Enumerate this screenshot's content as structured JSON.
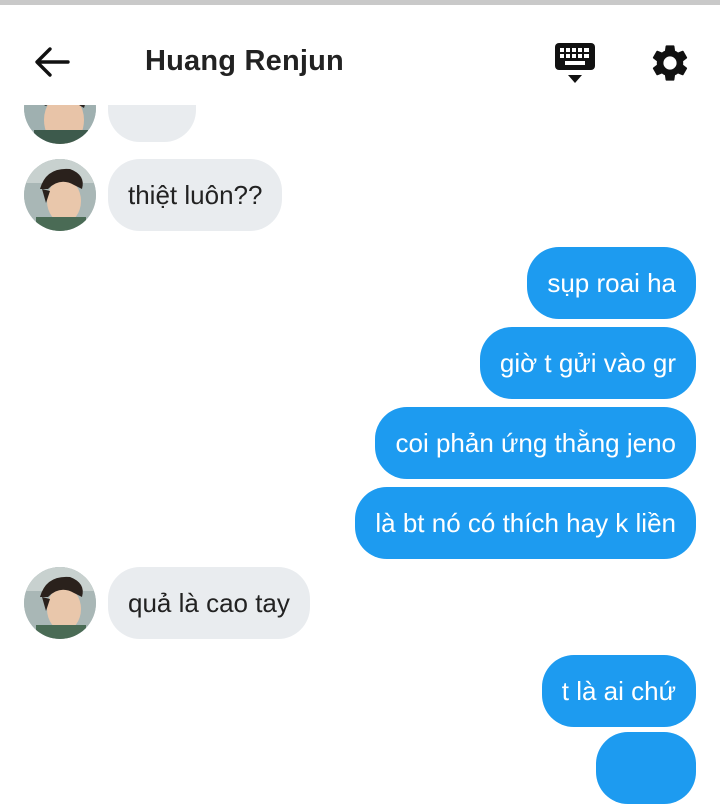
{
  "header": {
    "title": "Huang Renjun",
    "back_icon": "arrow-left-icon",
    "keyboard_icon": "keyboard-icon",
    "settings_icon": "gear-icon"
  },
  "colors": {
    "outgoing_bubble": "#1d9bf0",
    "incoming_bubble": "#e9ecef",
    "text_dark": "#222222"
  },
  "messages": [
    {
      "side": "in",
      "text": "thiệt luôn??"
    },
    {
      "side": "out",
      "text": "sụp roai ha"
    },
    {
      "side": "out",
      "text": "giờ t gửi vào gr"
    },
    {
      "side": "out",
      "text": "coi phản ứng thằng jeno"
    },
    {
      "side": "out",
      "text": "là bt nó có thích hay k liền"
    },
    {
      "side": "in",
      "text": "quả là cao tay"
    },
    {
      "side": "out",
      "text": "t là ai chứ"
    }
  ]
}
